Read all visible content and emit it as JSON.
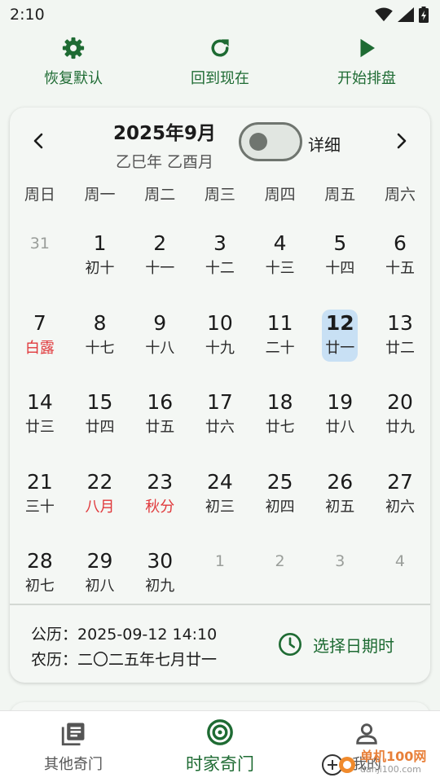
{
  "status_bar": {
    "time": "2:10"
  },
  "toolbar": {
    "restore_label": "恢复默认",
    "now_label": "回到现在",
    "start_label": "开始排盘"
  },
  "calendar": {
    "month_title": "2025年9月",
    "ganzhi": "乙巳年 乙酉月",
    "detail_label": "详细",
    "detail_on": false,
    "weekdays": [
      "周日",
      "周一",
      "周二",
      "周三",
      "周四",
      "周五",
      "周六"
    ],
    "days": [
      {
        "day": "31",
        "lunar": "",
        "other": true
      },
      {
        "day": "1",
        "lunar": "初十"
      },
      {
        "day": "2",
        "lunar": "十一"
      },
      {
        "day": "3",
        "lunar": "十二"
      },
      {
        "day": "4",
        "lunar": "十三"
      },
      {
        "day": "5",
        "lunar": "十四"
      },
      {
        "day": "6",
        "lunar": "十五"
      },
      {
        "day": "7",
        "lunar": "白露",
        "red": true
      },
      {
        "day": "8",
        "lunar": "十七"
      },
      {
        "day": "9",
        "lunar": "十八"
      },
      {
        "day": "10",
        "lunar": "十九"
      },
      {
        "day": "11",
        "lunar": "二十"
      },
      {
        "day": "12",
        "lunar": "廿一",
        "today": true
      },
      {
        "day": "13",
        "lunar": "廿二"
      },
      {
        "day": "14",
        "lunar": "廿三"
      },
      {
        "day": "15",
        "lunar": "廿四"
      },
      {
        "day": "16",
        "lunar": "廿五"
      },
      {
        "day": "17",
        "lunar": "廿六"
      },
      {
        "day": "18",
        "lunar": "廿七"
      },
      {
        "day": "19",
        "lunar": "廿八"
      },
      {
        "day": "20",
        "lunar": "廿九"
      },
      {
        "day": "21",
        "lunar": "三十"
      },
      {
        "day": "22",
        "lunar": "八月",
        "red": true
      },
      {
        "day": "23",
        "lunar": "秋分",
        "red": true
      },
      {
        "day": "24",
        "lunar": "初三"
      },
      {
        "day": "25",
        "lunar": "初四"
      },
      {
        "day": "26",
        "lunar": "初五"
      },
      {
        "day": "27",
        "lunar": "初六"
      },
      {
        "day": "28",
        "lunar": "初七"
      },
      {
        "day": "29",
        "lunar": "初八"
      },
      {
        "day": "30",
        "lunar": "初九"
      },
      {
        "day": "1",
        "lunar": "",
        "other": true
      },
      {
        "day": "2",
        "lunar": "",
        "other": true
      },
      {
        "day": "3",
        "lunar": "",
        "other": true
      },
      {
        "day": "4",
        "lunar": "",
        "other": true
      }
    ]
  },
  "footer": {
    "solar_label": "公历：",
    "solar_value": "2025-09-12 14:10",
    "lunar_label": "农历：",
    "lunar_value": "二〇二五年七月廿一",
    "pick_label": "选择日期时"
  },
  "bottom_nav": {
    "other_label": "其他奇门",
    "main_label": "时家奇门",
    "profile_label": "我的"
  },
  "watermark": {
    "cn": "单机100网",
    "en": "danji100.com"
  },
  "colors": {
    "accent": "#1e6b33",
    "holiday": "#e0383b",
    "today_bg": "#c8e0f4"
  }
}
